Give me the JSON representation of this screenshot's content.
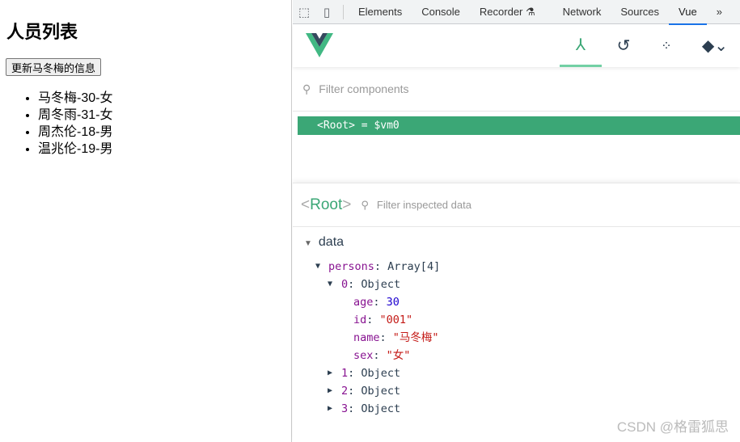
{
  "page": {
    "title": "人员列表",
    "button": "更新马冬梅的信息",
    "items": [
      "马冬梅-30-女",
      "周冬雨-31-女",
      "周杰伦-18-男",
      "温兆伦-19-男"
    ]
  },
  "devtools": {
    "tabs": [
      "Elements",
      "Console",
      "Recorder",
      "Network",
      "Sources",
      "Vue"
    ],
    "active_tab": "Vue",
    "more": "»"
  },
  "vue": {
    "filter_placeholder": "Filter components",
    "root_label": "<Root>",
    "root_var": "= $vm0",
    "inspector_title": "Root",
    "inspect_placeholder": "Filter inspected data",
    "section": "data",
    "persons_key": "persons",
    "persons_val": "Array[4]",
    "obj0": {
      "key": "0",
      "val": "Object",
      "fields": [
        {
          "k": "age",
          "v": "30"
        },
        {
          "k": "id",
          "v": "\"001\""
        },
        {
          "k": "name",
          "v": "\"马冬梅\""
        },
        {
          "k": "sex",
          "v": "\"女\""
        }
      ]
    },
    "others": [
      {
        "key": "1",
        "val": "Object"
      },
      {
        "key": "2",
        "val": "Object"
      },
      {
        "key": "3",
        "val": "Object"
      }
    ],
    "accent": "#3ba776"
  },
  "watermark": "CSDN @格雷狐思"
}
